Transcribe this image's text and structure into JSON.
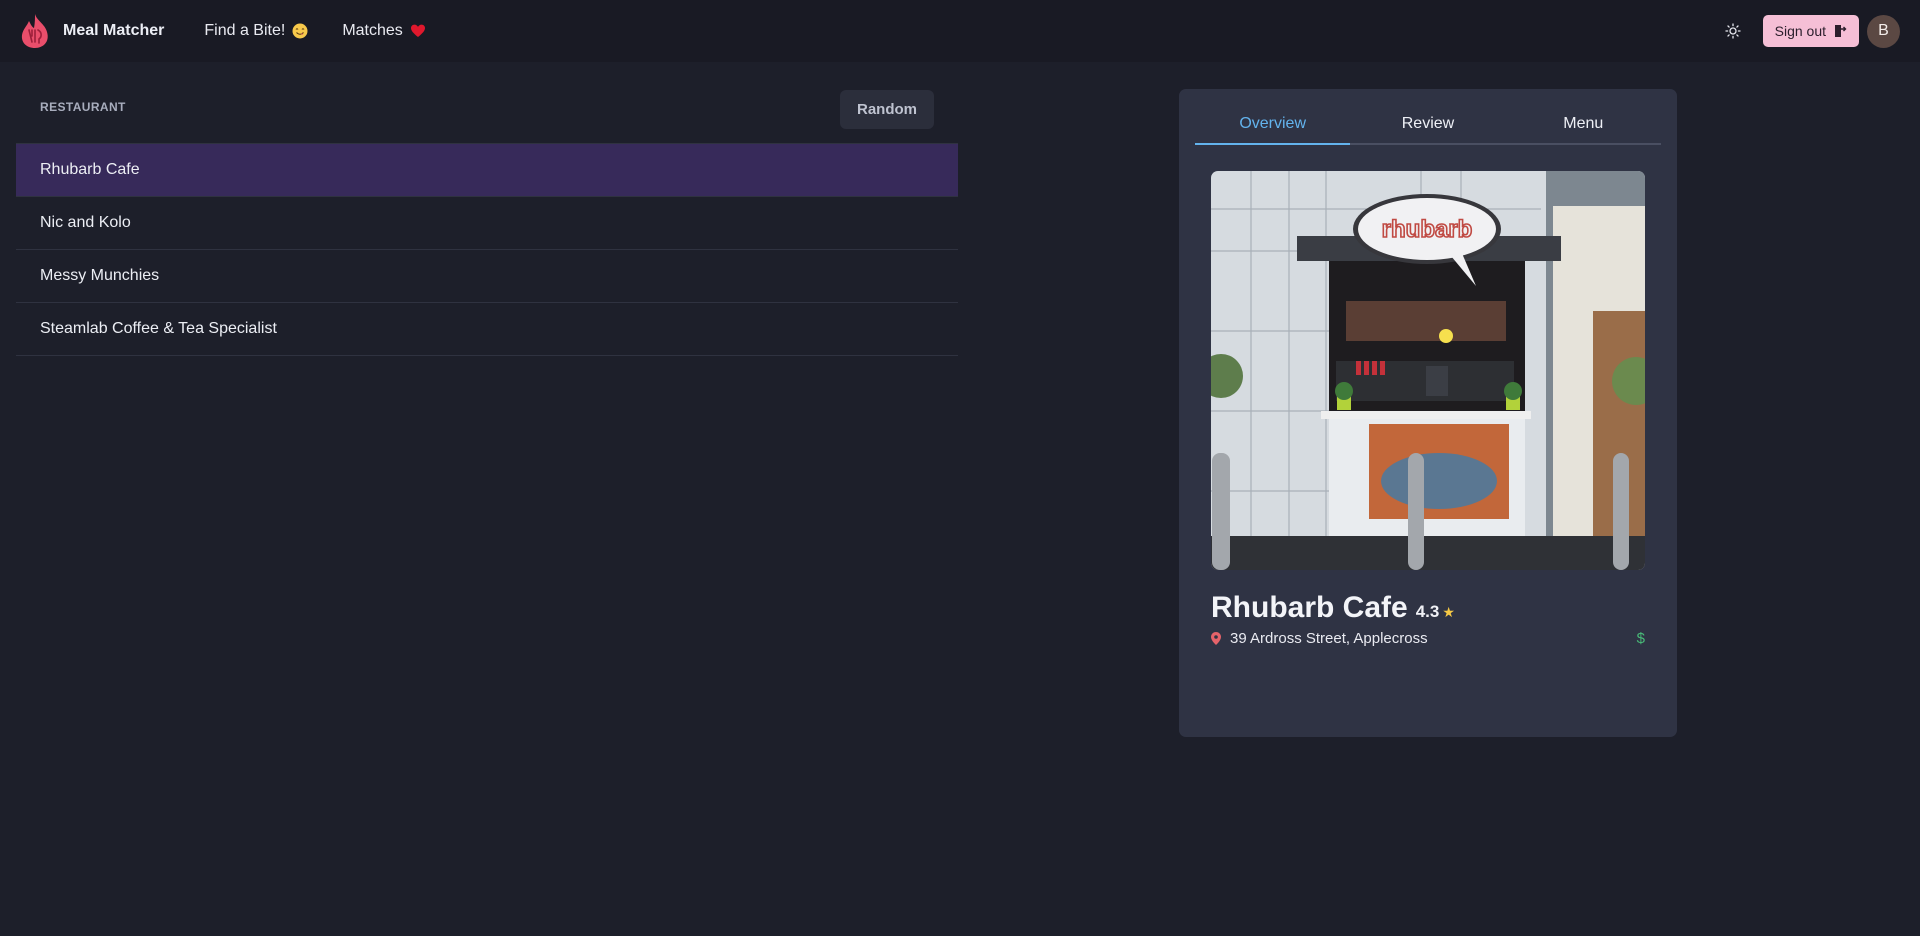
{
  "nav": {
    "brand": "Meal Matcher",
    "find_label": "Find a Bite!",
    "matches_label": "Matches",
    "signout_label": "Sign out",
    "avatar_initial": "B"
  },
  "list": {
    "heading": "RESTAURANT",
    "random_label": "Random",
    "items": [
      {
        "name": "Rhubarb Cafe",
        "selected": true
      },
      {
        "name": "Nic and Kolo",
        "selected": false
      },
      {
        "name": "Messy Munchies",
        "selected": false
      },
      {
        "name": "Steamlab Coffee & Tea Specialist",
        "selected": false
      }
    ]
  },
  "detail": {
    "tabs": [
      "Overview",
      "Review",
      "Menu"
    ],
    "active_tab": "Overview",
    "name": "Rhubarb Cafe",
    "rating": "4.3",
    "star": "★",
    "address": "39 Ardross Street, Applecross",
    "price": "$",
    "photo_sign": "rhubarb"
  },
  "colors": {
    "background": "#1d1f2a",
    "navbar": "#191a24",
    "selected_row": "#372a5a",
    "card": "#2f3344",
    "accent_tab": "#63b3ed",
    "signout_bg": "#f5bfd6",
    "price": "#48bb78",
    "star": "#f6c945"
  }
}
